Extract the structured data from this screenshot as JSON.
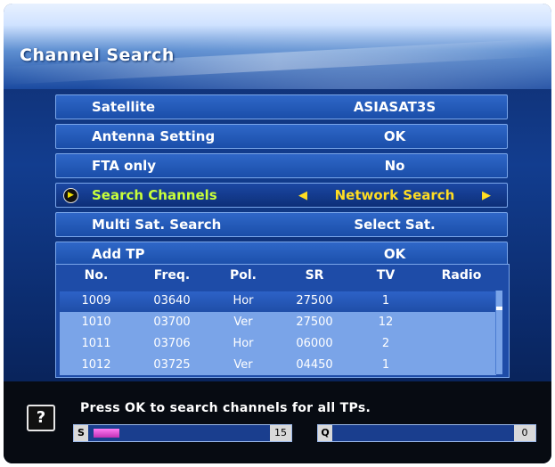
{
  "header": {
    "title": "Channel Search"
  },
  "menu": [
    {
      "label": "Satellite",
      "value": "ASIASAT3S"
    },
    {
      "label": "Antenna Setting",
      "value": "OK"
    },
    {
      "label": "FTA only",
      "value": "No"
    },
    {
      "label": "Search Channels",
      "value": "Network Search",
      "active": true
    },
    {
      "label": "Multi Sat. Search",
      "value": "Select Sat."
    },
    {
      "label": "Add TP",
      "value": "OK"
    }
  ],
  "table": {
    "columns": [
      "No.",
      "Freq.",
      "Pol.",
      "SR",
      "TV",
      "Radio"
    ],
    "rows": [
      [
        "1009",
        "03640",
        "Hor",
        "27500",
        "1",
        ""
      ],
      [
        "1010",
        "03700",
        "Ver",
        "27500",
        "12",
        ""
      ],
      [
        "1011",
        "03706",
        "Hor",
        "06000",
        "2",
        ""
      ],
      [
        "1012",
        "03725",
        "Ver",
        "04450",
        "1",
        ""
      ]
    ]
  },
  "footer": {
    "hint": "Press OK to search channels for all TPs.",
    "help_icon": "?",
    "signal": {
      "tag": "S",
      "value": "15",
      "level_percent": 15
    },
    "quality": {
      "tag": "Q",
      "value": "0",
      "level_percent": 0
    }
  },
  "colors": {
    "active_label": "#c8ff3a",
    "active_value": "#ffdd22",
    "signal_fill": "#e060dc"
  }
}
